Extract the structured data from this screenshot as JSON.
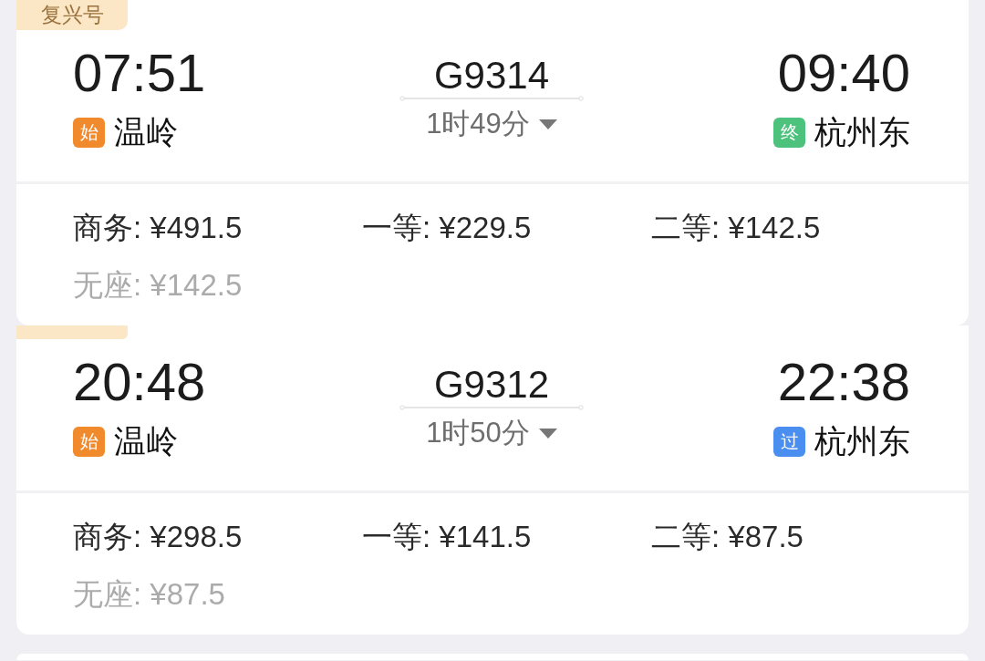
{
  "trains": [
    {
      "badge": "复兴号",
      "departure": {
        "time": "07:51",
        "mark": "始",
        "color": "#f08a2c",
        "station": "温岭"
      },
      "train_no": "G9314",
      "duration": "1时49分",
      "arrival": {
        "time": "09:40",
        "mark": "终",
        "color": "#4cc27c",
        "station": "杭州东"
      },
      "fares": [
        {
          "text": "商务: ¥491.5",
          "disabled": false
        },
        {
          "text": "一等: ¥229.5",
          "disabled": false
        },
        {
          "text": "二等: ¥142.5",
          "disabled": false
        },
        {
          "text": "无座: ¥142.5",
          "disabled": true
        }
      ]
    },
    {
      "badge_covered": true,
      "departure": {
        "time": "20:48",
        "mark": "始",
        "color": "#f08a2c",
        "station": "温岭"
      },
      "train_no": "G9312",
      "duration": "1时50分",
      "arrival": {
        "time": "22:38",
        "mark": "过",
        "color": "#4a8ff0",
        "station": "杭州东"
      },
      "fares": [
        {
          "text": "商务: ¥298.5",
          "disabled": false
        },
        {
          "text": "一等: ¥141.5",
          "disabled": false
        },
        {
          "text": "二等: ¥87.5",
          "disabled": false
        },
        {
          "text": "无座: ¥87.5",
          "disabled": true
        }
      ]
    }
  ]
}
